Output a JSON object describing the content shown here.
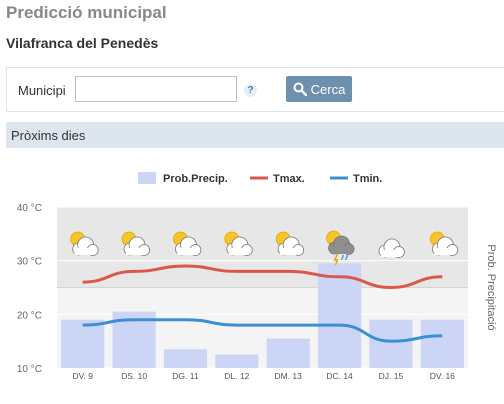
{
  "page": {
    "title": "Predicció municipal",
    "location": "Vilafranca del Penedès"
  },
  "search": {
    "label": "Municipi",
    "value": "",
    "help_icon": "?",
    "button_label": "Cerca",
    "button_icon": "search-icon"
  },
  "section": {
    "title": "Pròxims dies"
  },
  "colors": {
    "precip": "#cdd5f7",
    "tmax": "#d9574b",
    "tmin": "#3c8fd3",
    "button": "#6f8fae"
  },
  "chart_data": {
    "type": "bar",
    "categories": [
      "DV. 9",
      "DS. 10",
      "DG. 11",
      "DL. 12",
      "DM. 13",
      "DC. 14",
      "DJ. 15",
      "DV. 16"
    ],
    "legend": [
      "Prob.Precip.",
      "Tmax.",
      "Tmin."
    ],
    "y_ticks": [
      "40 °C",
      "30 °C",
      "20 °C",
      "10 °C"
    ],
    "ylim": [
      10,
      40
    ],
    "y2label": "Prob. Precipitació",
    "series": [
      {
        "name": "Prob.Precip.",
        "type": "bar",
        "values": [
          19,
          20.5,
          13.5,
          12.5,
          15.5,
          29.5,
          19,
          19
        ]
      },
      {
        "name": "Tmax.",
        "type": "line",
        "values": [
          26,
          28,
          29,
          28,
          28,
          27,
          25,
          27
        ]
      },
      {
        "name": "Tmin.",
        "type": "line",
        "values": [
          18,
          19,
          19,
          18,
          18,
          18,
          15,
          16
        ]
      }
    ],
    "weather_icons": [
      "partly-cloudy-icon",
      "partly-cloudy-icon",
      "partly-cloudy-icon",
      "partly-cloudy-icon",
      "partly-cloudy-icon",
      "storm-icon",
      "cloudy-icon",
      "partly-cloudy-icon"
    ],
    "legend_position": "top",
    "grid": true
  }
}
